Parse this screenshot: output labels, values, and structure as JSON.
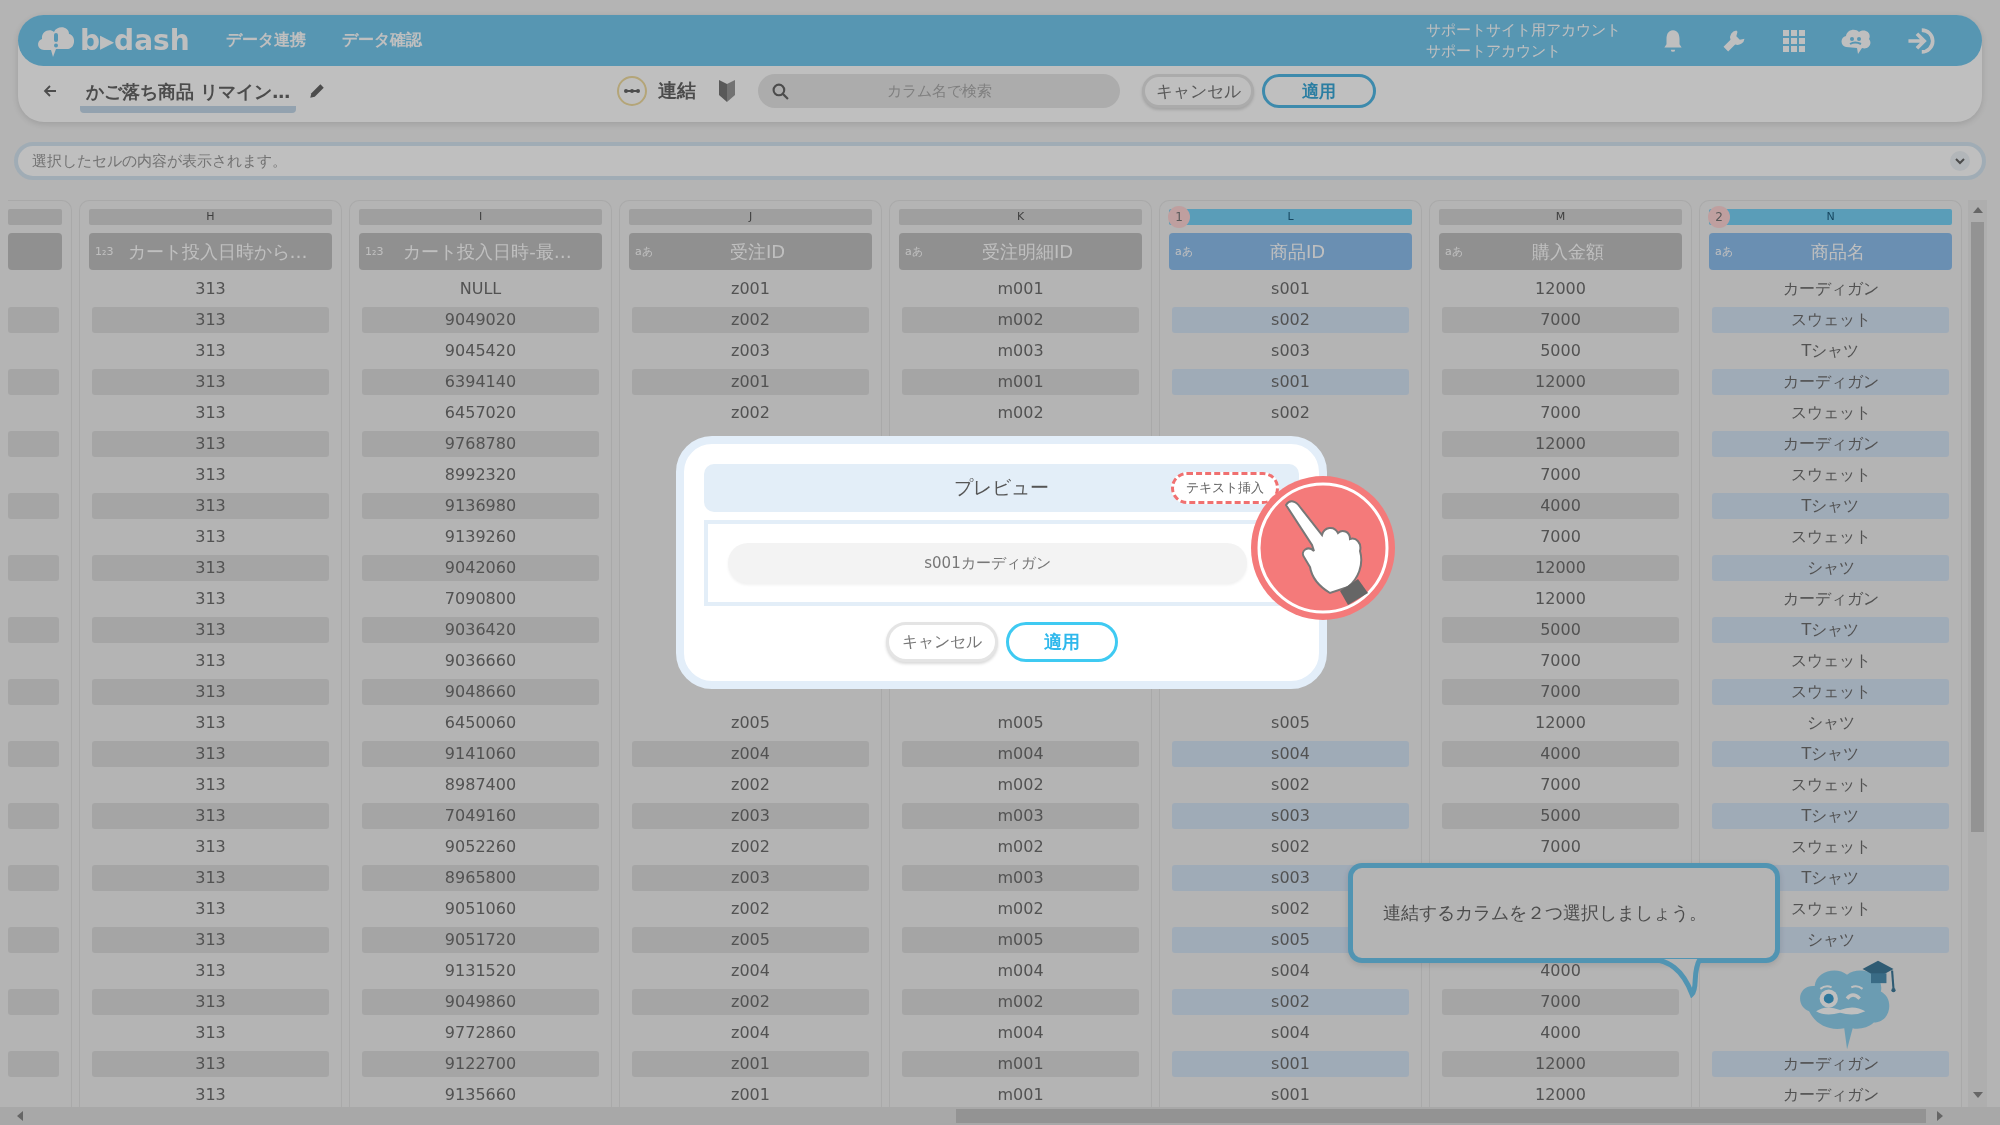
{
  "header": {
    "logo": "b▸dash",
    "nav": [
      "データ連携",
      "データ確認"
    ],
    "account": [
      "サポートサイト用アカウント",
      "サポートアカウント"
    ]
  },
  "toolbar": {
    "title": "かご落ち商品 リマイン…",
    "mode_label": "連結",
    "search": {
      "placeholder": "カラム名で検索"
    },
    "buttons": [
      {
        "label": "キャンセル",
        "kind": "secondary"
      },
      {
        "label": "適用",
        "kind": "primary"
      }
    ]
  },
  "cell_viewer": {
    "placeholder": "選択したセルの内容が表示されます。"
  },
  "table": {
    "columns": [
      {
        "letter": "H",
        "type_label": "1₂3",
        "title": "カート投入日時から…",
        "selected": false,
        "cells": [
          "313",
          "313",
          "313",
          "313",
          "313",
          "313",
          "313",
          "313",
          "313",
          "313",
          "313",
          "313",
          "313",
          "313",
          "313",
          "313",
          "313",
          "313",
          "313",
          "313",
          "313",
          "313",
          "313",
          "313",
          "313",
          "313",
          "313"
        ]
      },
      {
        "letter": "I",
        "type_label": "1₂3",
        "title": "カート投入日時-最…",
        "selected": false,
        "cells": [
          "NULL",
          "9049020",
          "9045420",
          "6394140",
          "6457020",
          "9768780",
          "8992320",
          "9136980",
          "9139260",
          "9042060",
          "7090800",
          "9036420",
          "9036660",
          "9048660",
          "6450060",
          "9141060",
          "8987400",
          "7049160",
          "9052260",
          "8965800",
          "9051060",
          "9051720",
          "9131520",
          "9049860",
          "9772860",
          "9122700",
          "9135660"
        ]
      },
      {
        "letter": "J",
        "type_label": "aあ",
        "title": "受注ID",
        "selected": false,
        "cells": [
          "z001",
          "z002",
          "z003",
          "z001",
          "z002",
          null,
          null,
          null,
          null,
          null,
          null,
          null,
          null,
          null,
          "z005",
          "z004",
          "z002",
          "z003",
          "z002",
          "z003",
          "z002",
          "z005",
          "z004",
          "z002",
          "z004",
          "z001",
          "z001"
        ]
      },
      {
        "letter": "K",
        "type_label": "aあ",
        "title": "受注明細ID",
        "selected": false,
        "cells": [
          "m001",
          "m002",
          "m003",
          "m001",
          "m002",
          null,
          null,
          null,
          null,
          null,
          null,
          null,
          null,
          null,
          "m005",
          "m004",
          "m002",
          "m003",
          "m002",
          "m003",
          "m002",
          "m005",
          "m004",
          "m002",
          "m004",
          "m001",
          "m001"
        ]
      },
      {
        "letter": "L",
        "type_label": "aあ",
        "title": "商品ID",
        "selected": true,
        "selection_order": "1",
        "cells": [
          "s001",
          "s002",
          "s003",
          "s001",
          "s002",
          null,
          null,
          null,
          null,
          null,
          null,
          null,
          null,
          null,
          "s005",
          "s004",
          "s002",
          "s003",
          "s002",
          "s003",
          "s002",
          "s005",
          "s004",
          "s002",
          "s004",
          "s001",
          "s001"
        ]
      },
      {
        "letter": "M",
        "type_label": "aあ",
        "title": "購入金額",
        "selected": false,
        "cells": [
          "12000",
          "7000",
          "5000",
          "12000",
          "7000",
          "12000",
          "7000",
          "4000",
          "7000",
          "12000",
          "12000",
          "5000",
          "7000",
          "7000",
          "12000",
          "4000",
          "7000",
          "5000",
          "7000",
          null,
          null,
          null,
          "4000",
          "7000",
          "4000",
          "12000",
          "12000"
        ]
      },
      {
        "letter": "N",
        "type_label": "aあ",
        "title": "商品名",
        "selected": true,
        "selection_order": "2",
        "cells": [
          "カーディガン",
          "スウェット",
          "Tシャツ",
          "カーディガン",
          "スウェット",
          "カーディガン",
          "スウェット",
          "Tシャツ",
          "スウェット",
          "シャツ",
          "カーディガン",
          "Tシャツ",
          "スウェット",
          "スウェット",
          "シャツ",
          "Tシャツ",
          "スウェット",
          "Tシャツ",
          "スウェット",
          "Tシャツ",
          "スウェット",
          "シャツ",
          null,
          null,
          null,
          "カーディガン",
          "カーディガン"
        ]
      }
    ]
  },
  "dialog": {
    "title": "プレビュー",
    "insert_button": "テキスト挿入",
    "preview_value": "s001カーディガン",
    "buttons": [
      {
        "label": "キャンセル",
        "kind": "secondary"
      },
      {
        "label": "適用",
        "kind": "primary"
      }
    ]
  },
  "tooltip": {
    "text": "連結するカラムを２つ選択しましょう。"
  }
}
